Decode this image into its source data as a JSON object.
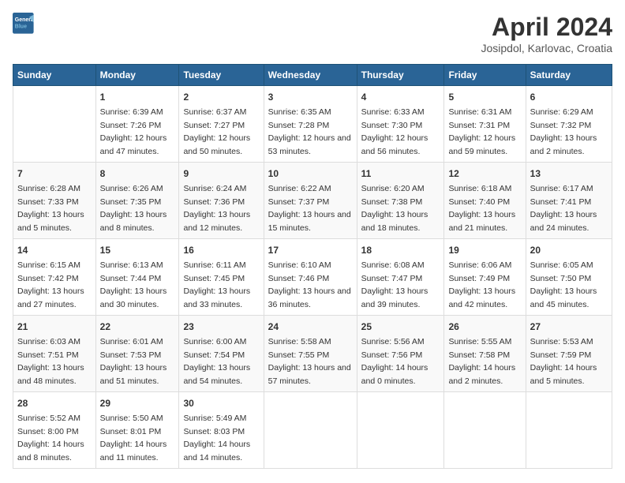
{
  "header": {
    "logo": {
      "line1": "General",
      "line2": "Blue"
    },
    "title": "April 2024",
    "subtitle": "Josipdol, Karlovac, Croatia"
  },
  "columns": [
    "Sunday",
    "Monday",
    "Tuesday",
    "Wednesday",
    "Thursday",
    "Friday",
    "Saturday"
  ],
  "weeks": [
    [
      {
        "day": "",
        "sunrise": "",
        "sunset": "",
        "daylight": ""
      },
      {
        "day": "1",
        "sunrise": "Sunrise: 6:39 AM",
        "sunset": "Sunset: 7:26 PM",
        "daylight": "Daylight: 12 hours and 47 minutes."
      },
      {
        "day": "2",
        "sunrise": "Sunrise: 6:37 AM",
        "sunset": "Sunset: 7:27 PM",
        "daylight": "Daylight: 12 hours and 50 minutes."
      },
      {
        "day": "3",
        "sunrise": "Sunrise: 6:35 AM",
        "sunset": "Sunset: 7:28 PM",
        "daylight": "Daylight: 12 hours and 53 minutes."
      },
      {
        "day": "4",
        "sunrise": "Sunrise: 6:33 AM",
        "sunset": "Sunset: 7:30 PM",
        "daylight": "Daylight: 12 hours and 56 minutes."
      },
      {
        "day": "5",
        "sunrise": "Sunrise: 6:31 AM",
        "sunset": "Sunset: 7:31 PM",
        "daylight": "Daylight: 12 hours and 59 minutes."
      },
      {
        "day": "6",
        "sunrise": "Sunrise: 6:29 AM",
        "sunset": "Sunset: 7:32 PM",
        "daylight": "Daylight: 13 hours and 2 minutes."
      }
    ],
    [
      {
        "day": "7",
        "sunrise": "Sunrise: 6:28 AM",
        "sunset": "Sunset: 7:33 PM",
        "daylight": "Daylight: 13 hours and 5 minutes."
      },
      {
        "day": "8",
        "sunrise": "Sunrise: 6:26 AM",
        "sunset": "Sunset: 7:35 PM",
        "daylight": "Daylight: 13 hours and 8 minutes."
      },
      {
        "day": "9",
        "sunrise": "Sunrise: 6:24 AM",
        "sunset": "Sunset: 7:36 PM",
        "daylight": "Daylight: 13 hours and 12 minutes."
      },
      {
        "day": "10",
        "sunrise": "Sunrise: 6:22 AM",
        "sunset": "Sunset: 7:37 PM",
        "daylight": "Daylight: 13 hours and 15 minutes."
      },
      {
        "day": "11",
        "sunrise": "Sunrise: 6:20 AM",
        "sunset": "Sunset: 7:38 PM",
        "daylight": "Daylight: 13 hours and 18 minutes."
      },
      {
        "day": "12",
        "sunrise": "Sunrise: 6:18 AM",
        "sunset": "Sunset: 7:40 PM",
        "daylight": "Daylight: 13 hours and 21 minutes."
      },
      {
        "day": "13",
        "sunrise": "Sunrise: 6:17 AM",
        "sunset": "Sunset: 7:41 PM",
        "daylight": "Daylight: 13 hours and 24 minutes."
      }
    ],
    [
      {
        "day": "14",
        "sunrise": "Sunrise: 6:15 AM",
        "sunset": "Sunset: 7:42 PM",
        "daylight": "Daylight: 13 hours and 27 minutes."
      },
      {
        "day": "15",
        "sunrise": "Sunrise: 6:13 AM",
        "sunset": "Sunset: 7:44 PM",
        "daylight": "Daylight: 13 hours and 30 minutes."
      },
      {
        "day": "16",
        "sunrise": "Sunrise: 6:11 AM",
        "sunset": "Sunset: 7:45 PM",
        "daylight": "Daylight: 13 hours and 33 minutes."
      },
      {
        "day": "17",
        "sunrise": "Sunrise: 6:10 AM",
        "sunset": "Sunset: 7:46 PM",
        "daylight": "Daylight: 13 hours and 36 minutes."
      },
      {
        "day": "18",
        "sunrise": "Sunrise: 6:08 AM",
        "sunset": "Sunset: 7:47 PM",
        "daylight": "Daylight: 13 hours and 39 minutes."
      },
      {
        "day": "19",
        "sunrise": "Sunrise: 6:06 AM",
        "sunset": "Sunset: 7:49 PM",
        "daylight": "Daylight: 13 hours and 42 minutes."
      },
      {
        "day": "20",
        "sunrise": "Sunrise: 6:05 AM",
        "sunset": "Sunset: 7:50 PM",
        "daylight": "Daylight: 13 hours and 45 minutes."
      }
    ],
    [
      {
        "day": "21",
        "sunrise": "Sunrise: 6:03 AM",
        "sunset": "Sunset: 7:51 PM",
        "daylight": "Daylight: 13 hours and 48 minutes."
      },
      {
        "day": "22",
        "sunrise": "Sunrise: 6:01 AM",
        "sunset": "Sunset: 7:53 PM",
        "daylight": "Daylight: 13 hours and 51 minutes."
      },
      {
        "day": "23",
        "sunrise": "Sunrise: 6:00 AM",
        "sunset": "Sunset: 7:54 PM",
        "daylight": "Daylight: 13 hours and 54 minutes."
      },
      {
        "day": "24",
        "sunrise": "Sunrise: 5:58 AM",
        "sunset": "Sunset: 7:55 PM",
        "daylight": "Daylight: 13 hours and 57 minutes."
      },
      {
        "day": "25",
        "sunrise": "Sunrise: 5:56 AM",
        "sunset": "Sunset: 7:56 PM",
        "daylight": "Daylight: 14 hours and 0 minutes."
      },
      {
        "day": "26",
        "sunrise": "Sunrise: 5:55 AM",
        "sunset": "Sunset: 7:58 PM",
        "daylight": "Daylight: 14 hours and 2 minutes."
      },
      {
        "day": "27",
        "sunrise": "Sunrise: 5:53 AM",
        "sunset": "Sunset: 7:59 PM",
        "daylight": "Daylight: 14 hours and 5 minutes."
      }
    ],
    [
      {
        "day": "28",
        "sunrise": "Sunrise: 5:52 AM",
        "sunset": "Sunset: 8:00 PM",
        "daylight": "Daylight: 14 hours and 8 minutes."
      },
      {
        "day": "29",
        "sunrise": "Sunrise: 5:50 AM",
        "sunset": "Sunset: 8:01 PM",
        "daylight": "Daylight: 14 hours and 11 minutes."
      },
      {
        "day": "30",
        "sunrise": "Sunrise: 5:49 AM",
        "sunset": "Sunset: 8:03 PM",
        "daylight": "Daylight: 14 hours and 14 minutes."
      },
      {
        "day": "",
        "sunrise": "",
        "sunset": "",
        "daylight": ""
      },
      {
        "day": "",
        "sunrise": "",
        "sunset": "",
        "daylight": ""
      },
      {
        "day": "",
        "sunrise": "",
        "sunset": "",
        "daylight": ""
      },
      {
        "day": "",
        "sunrise": "",
        "sunset": "",
        "daylight": ""
      }
    ]
  ]
}
